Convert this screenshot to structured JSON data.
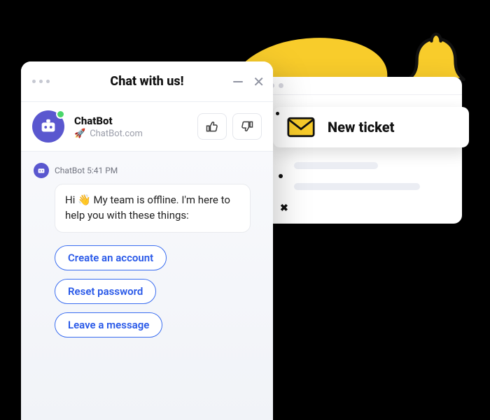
{
  "notification": {
    "label": "New ticket"
  },
  "chat": {
    "header": {
      "title": "Chat with us!"
    },
    "bot": {
      "name": "ChatBot",
      "site": "ChatBot.com",
      "rocket_emoji": "🚀"
    },
    "thread": {
      "author": "ChatBot",
      "time": "5:41 PM",
      "greeting_prefix": "Hi ",
      "wave_emoji": "👋",
      "greeting_rest": " My team is offline. I'm here to help you with these things:"
    },
    "chips": [
      "Create an account",
      "Reset password",
      "Leave a message"
    ]
  },
  "icons": {
    "bell": "bell-icon",
    "envelope": "envelope-icon",
    "thumbs_up": "thumbs-up-icon",
    "thumbs_down": "thumbs-down-icon"
  },
  "colors": {
    "accent_yellow": "#f8cc2b",
    "accent_blue": "#3a6df0",
    "bot_purple": "#5a57cf",
    "status_green": "#49d66a"
  }
}
